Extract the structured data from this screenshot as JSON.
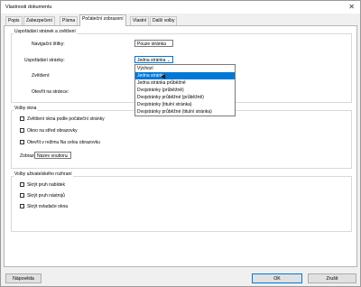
{
  "window": {
    "title": "Vlastnosti dokumentu"
  },
  "tabs": [
    {
      "label": "Popis"
    },
    {
      "label": "Zabezpečení"
    },
    {
      "label": "Písma"
    },
    {
      "label": "Počáteční zobrazení"
    },
    {
      "label": "Vlastní"
    },
    {
      "label": "Další volby"
    }
  ],
  "layout_group": {
    "title": "Uspořádání stránek a zvětšení",
    "nav_label": "Navigační štítky:",
    "nav_value": "Pouze stránka",
    "page_layout_label": "Uspořádání stránky:",
    "page_layout_value": "Jedna stránka",
    "zoom_label": "Zvětšení:",
    "open_label": "Otevřít na stránce:"
  },
  "dropdown_options": [
    {
      "label": "Výchozí"
    },
    {
      "label": "Jedna stránka"
    },
    {
      "label": "Jedna stránka průběžně"
    },
    {
      "label": "Dvojstránky (průběžně)"
    },
    {
      "label": "Dvojstránky průběžné (průběžně)"
    },
    {
      "label": "Dvojstránky (titulní stránka)"
    },
    {
      "label": "Dvojstránky průběžné (titulní stránka)"
    }
  ],
  "window_group": {
    "title": "Volby okna",
    "opt1": "Zvětšení okna podle počáteční stránky",
    "opt2": "Okno na střed obrazovky",
    "opt3": "Otevřít v režimu Na celou obrazovku",
    "show_label": "Zobrazit:",
    "show_value": "Název souboru"
  },
  "ui_group": {
    "title": "Volby uživatelského rozhraní",
    "opt1": "Skrýt pruh nabídek",
    "opt2": "Skrýt pruh nástrojů",
    "opt3": "Skrýt ovladače okna"
  },
  "buttons": {
    "help": "Nápověda",
    "ok": "OK",
    "cancel": "Zrušit"
  },
  "icons": {
    "close": "close-icon",
    "dropdown": "chevron-down-icon"
  }
}
